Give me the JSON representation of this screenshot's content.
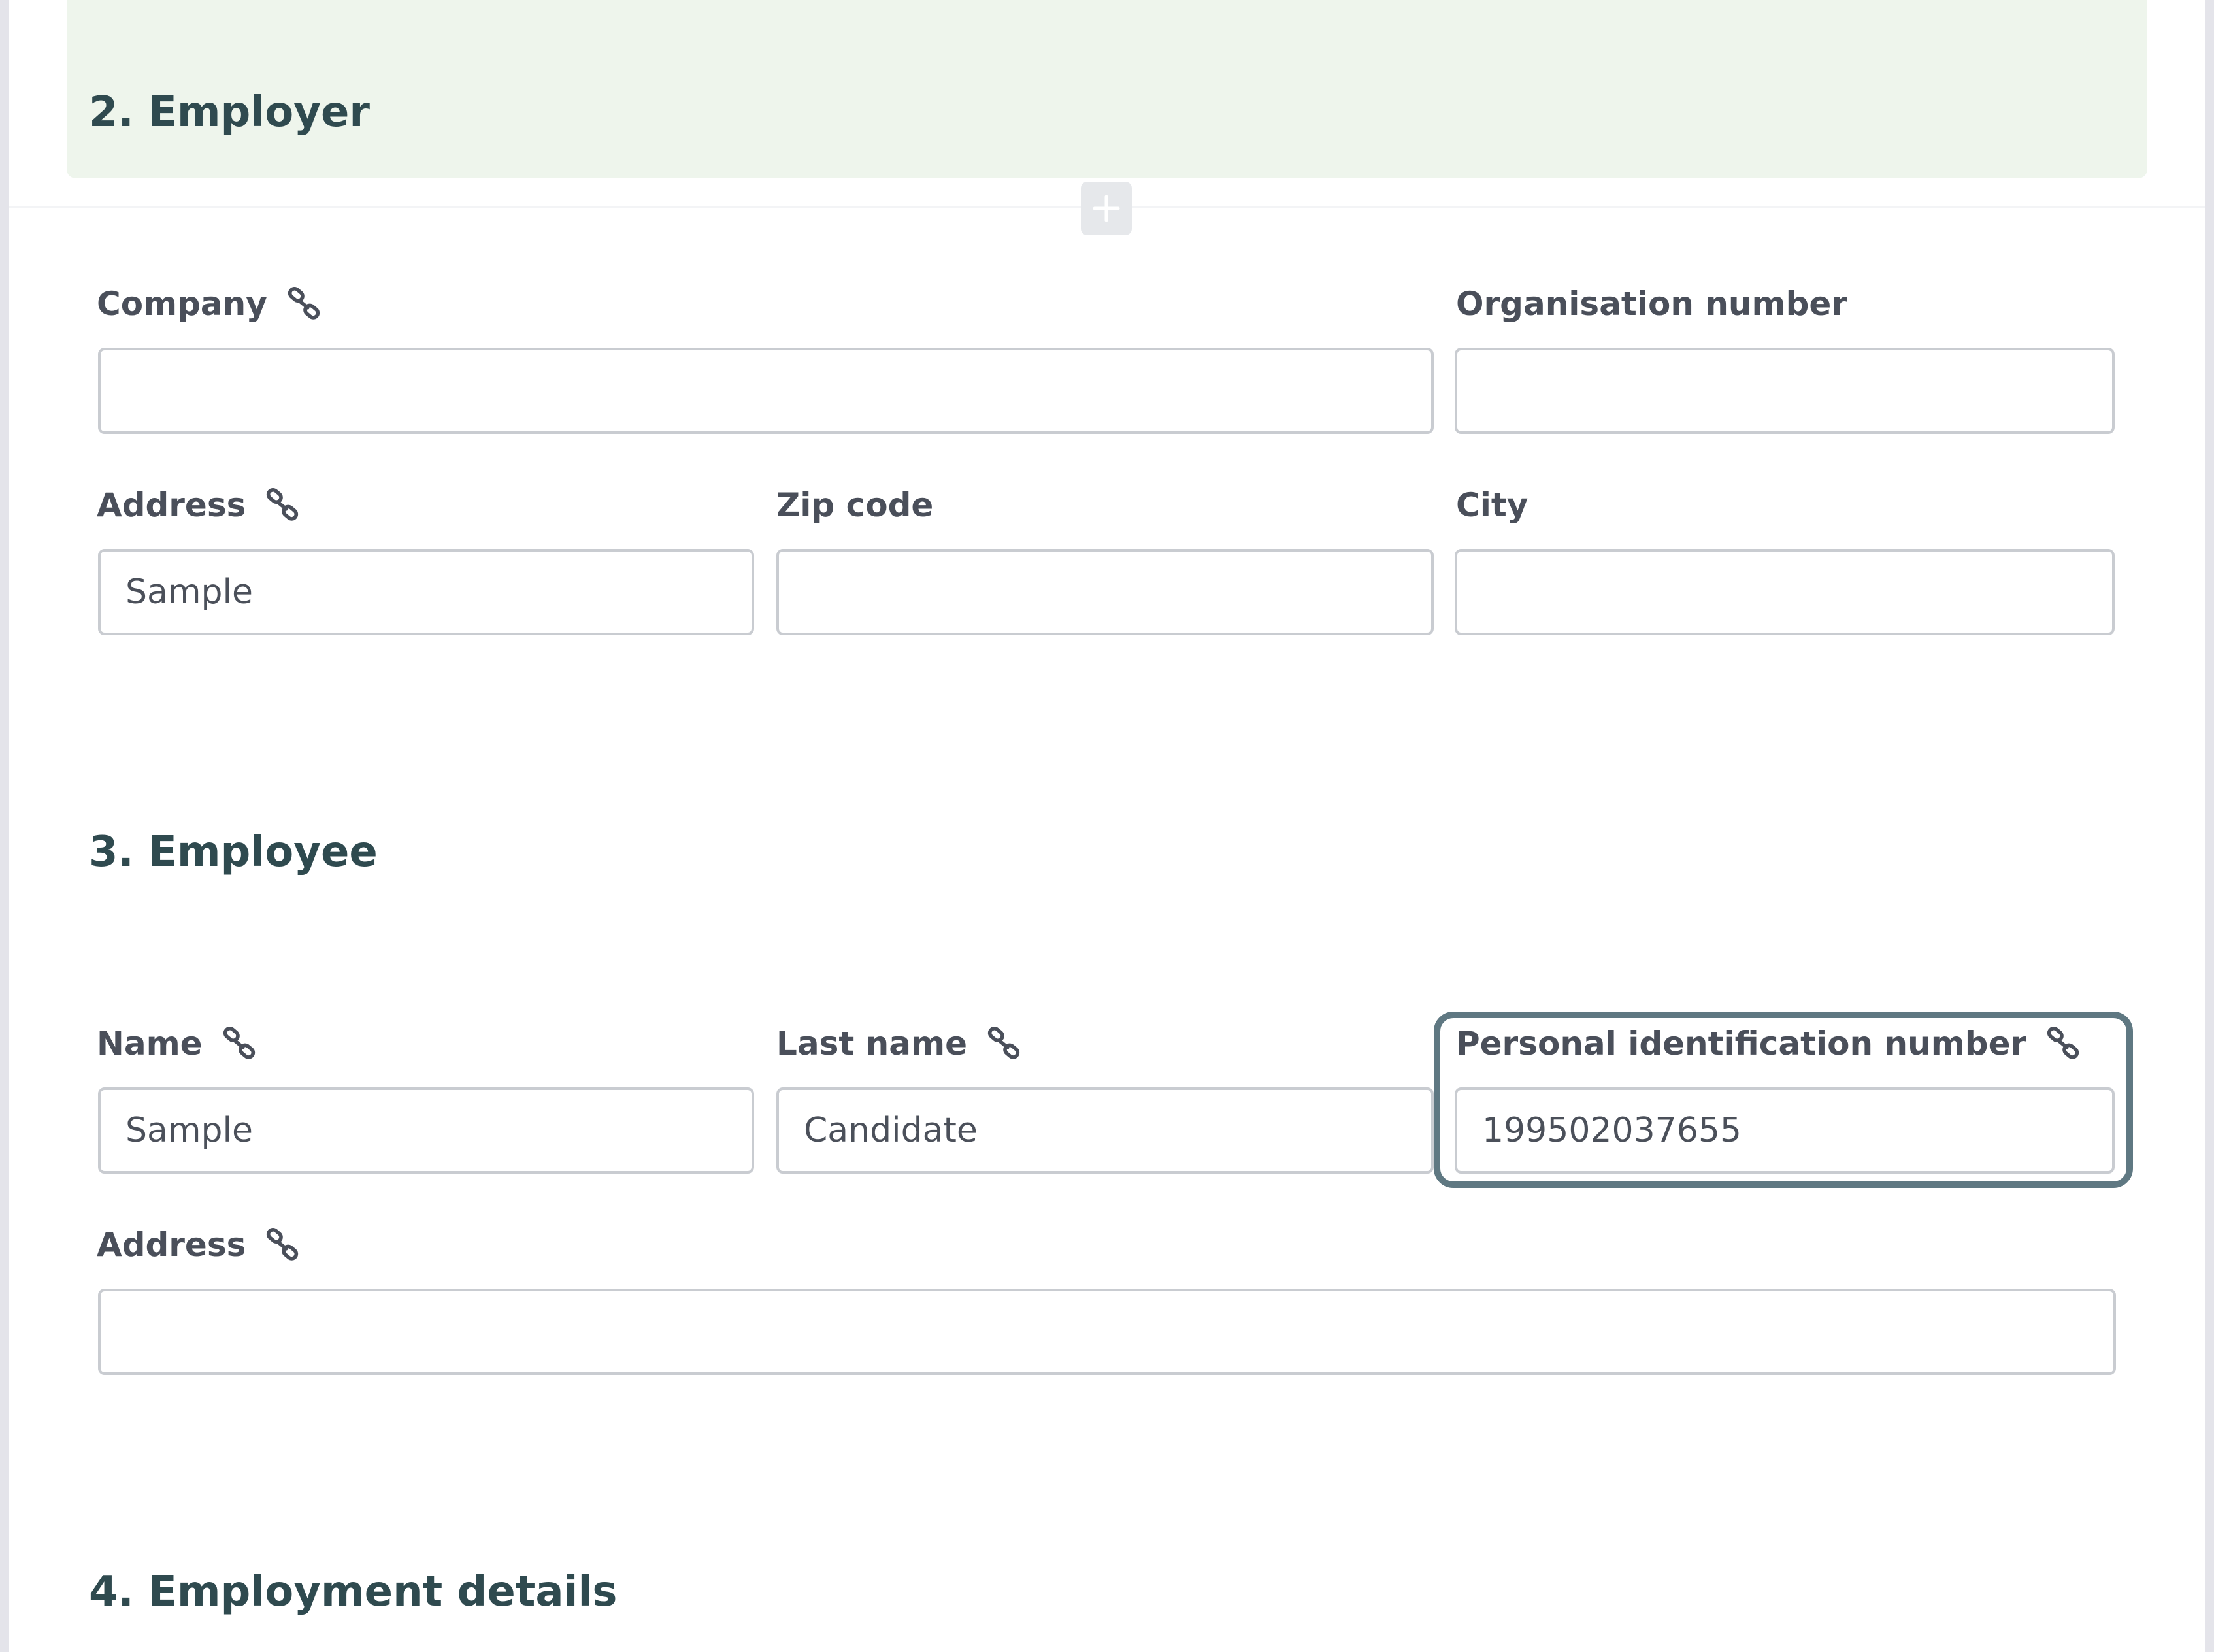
{
  "employer": {
    "heading": "2. Employer",
    "add_button_icon": "plus-icon",
    "company": {
      "label": "Company",
      "value": "",
      "icon": "link-icon"
    },
    "organisation_number": {
      "label": "Organisation number",
      "value": ""
    },
    "address": {
      "label": "Address",
      "value": "Sample",
      "icon": "link-icon"
    },
    "zip_code": {
      "label": "Zip code",
      "value": ""
    },
    "city": {
      "label": "City",
      "value": ""
    }
  },
  "employee": {
    "heading": "3. Employee",
    "name": {
      "label": "Name",
      "value": "Sample",
      "icon": "link-icon"
    },
    "last_name": {
      "label": "Last name",
      "value": "Candidate",
      "icon": "link-icon"
    },
    "personal_id": {
      "label": "Personal identification number",
      "value": "199502037655",
      "icon": "link-icon",
      "focused": true
    },
    "address": {
      "label": "Address",
      "value": "",
      "icon": "link-icon"
    }
  },
  "employment_details": {
    "heading": "4. Employment details"
  },
  "colors": {
    "section_bg": "#eef5ec",
    "heading": "#2f4a4f",
    "label": "#4a4f5a",
    "input_border": "#c9ccd1",
    "focus_border": "#5f7882"
  }
}
